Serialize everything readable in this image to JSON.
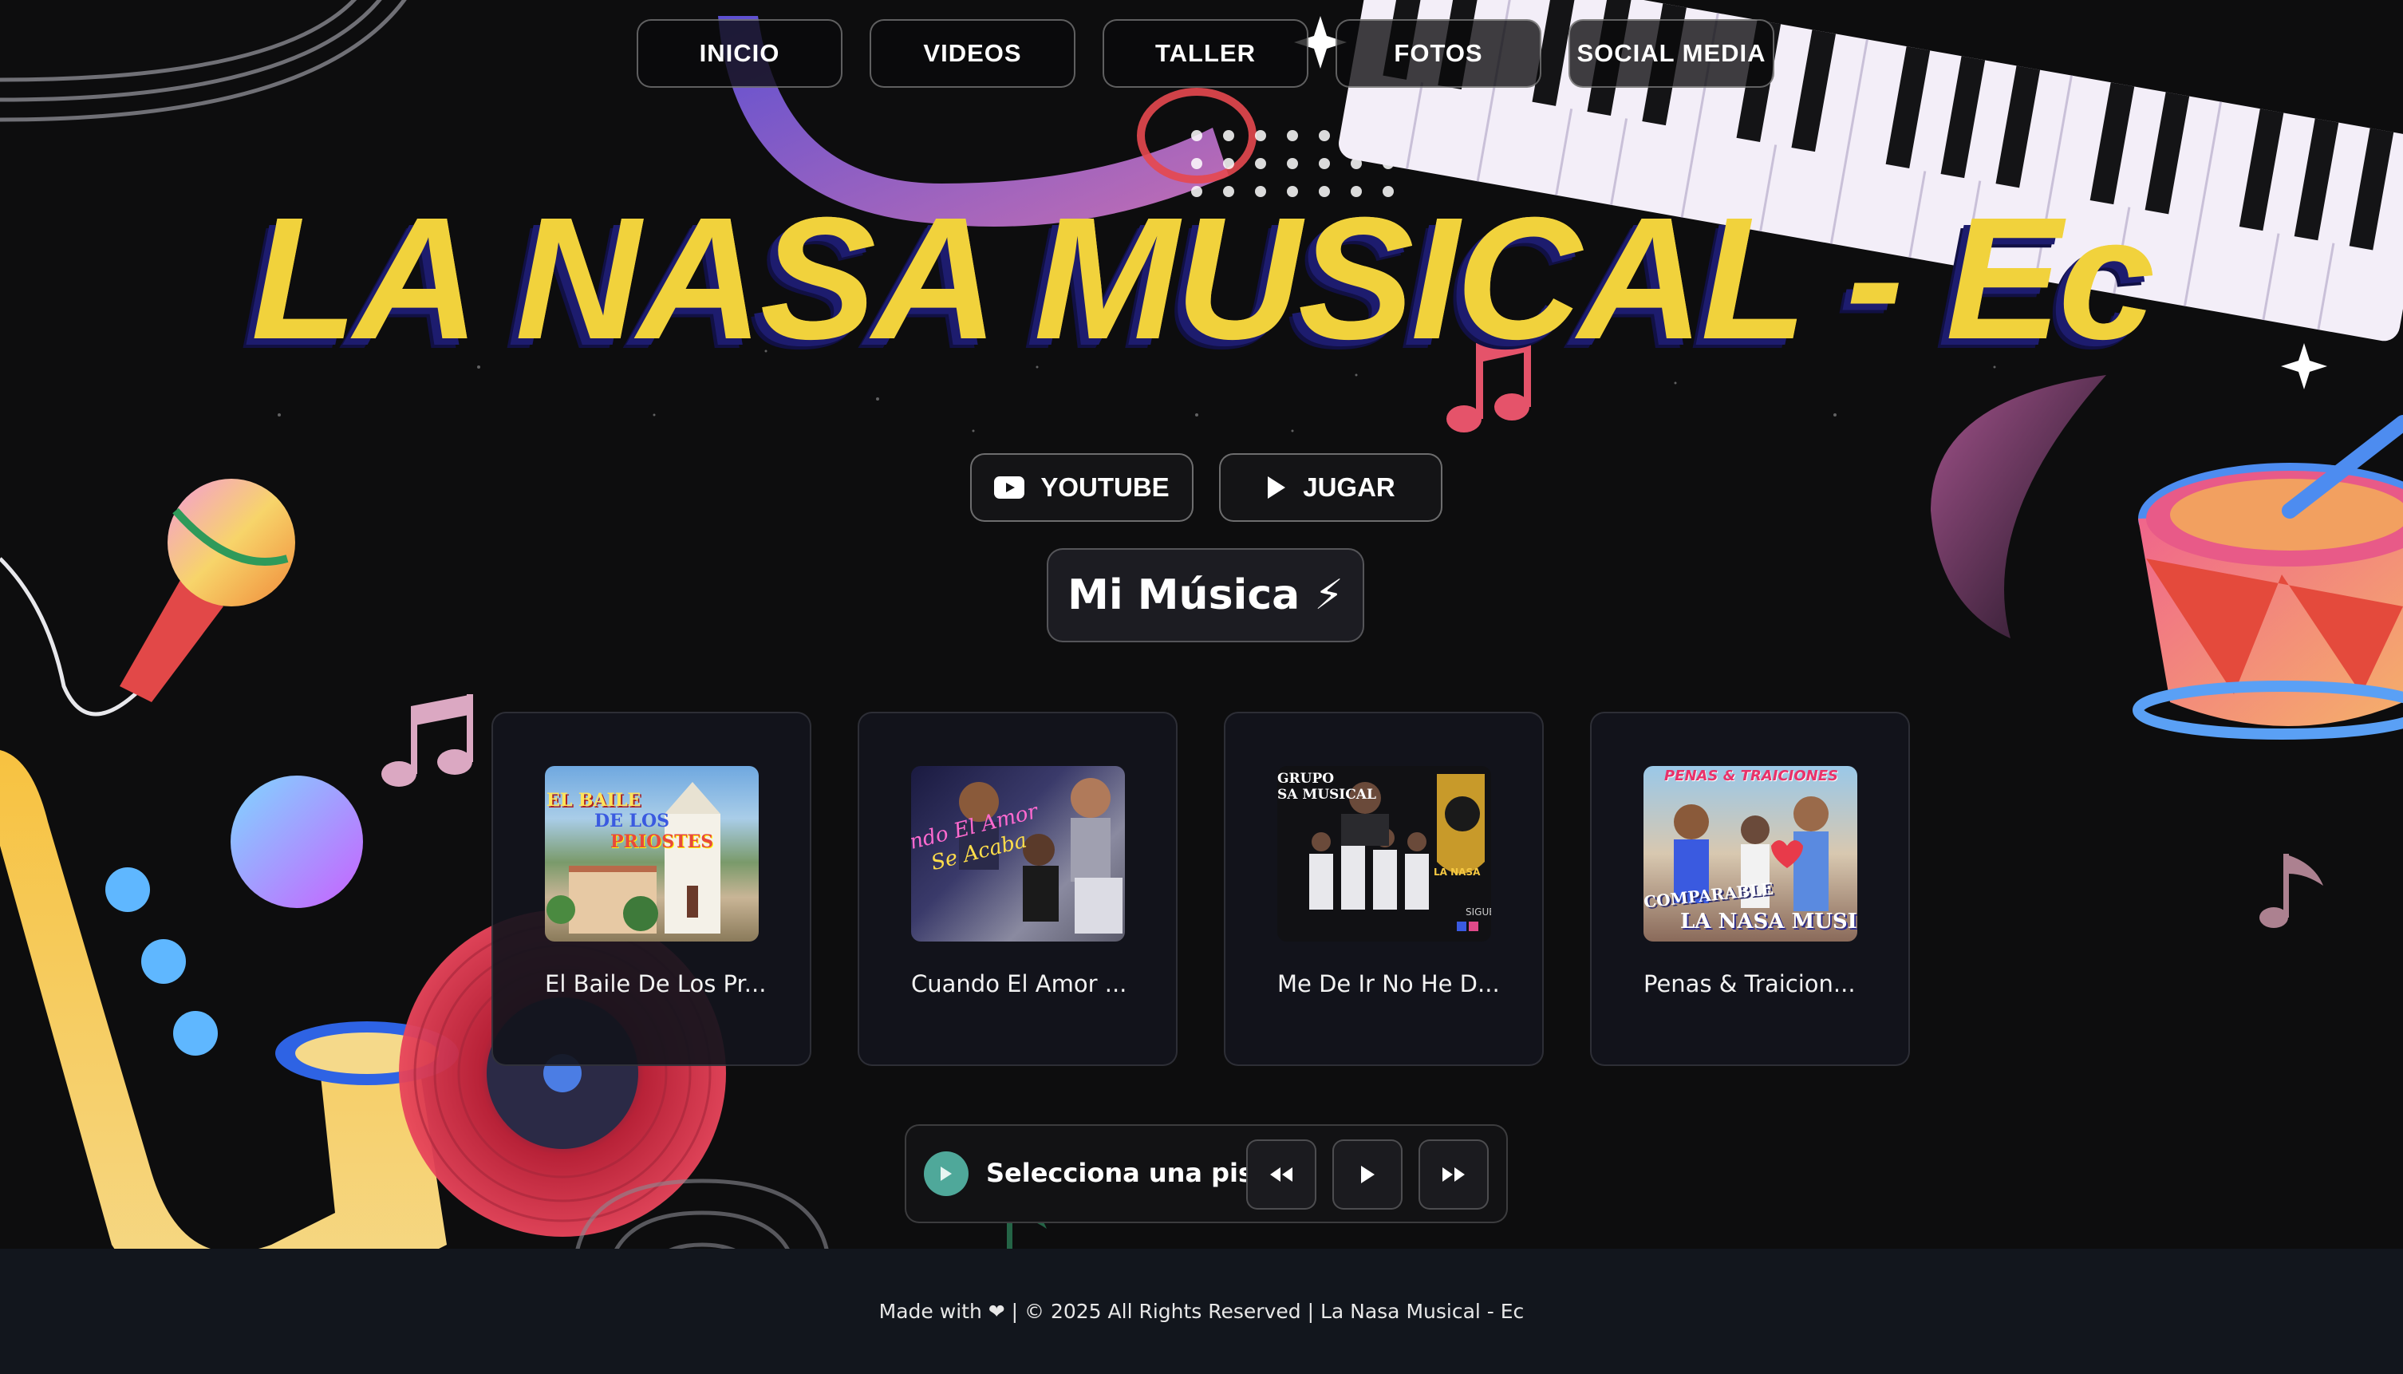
{
  "nav": {
    "items": [
      {
        "label": "INICIO"
      },
      {
        "label": "VIDEOS"
      },
      {
        "label": "TALLER"
      },
      {
        "label": "FOTOS"
      },
      {
        "label": "SOCIAL MEDIA"
      }
    ]
  },
  "hero": {
    "title": "LA NASA MUSICAL - Ec"
  },
  "actions": {
    "youtube_label": "YOUTUBE",
    "youtube_icon": "youtube-icon",
    "play_label": "JUGAR",
    "play_icon": "play-icon"
  },
  "section": {
    "title": "Mi Música ⚡"
  },
  "tracks": [
    {
      "title": "El Baile De Los Pr...",
      "thumb_text": [
        "EL BAILE",
        "DE LOS",
        "PRIOSTES"
      ]
    },
    {
      "title": "Cuando El Amor ...",
      "thumb_text": [
        "ndo El Amor",
        "Se Acaba"
      ]
    },
    {
      "title": "Me De Ir No He D...",
      "thumb_text": [
        "GRUPO",
        "SA MUSICAL",
        "LA NASA",
        "SIGUE"
      ]
    },
    {
      "title": "Penas & Traicion...",
      "thumb_text": [
        "PENAS & TRAICIONES",
        "COMPARABLE",
        "LA NASA MUSI"
      ]
    }
  ],
  "player": {
    "now_playing": "Selecciona una pista",
    "icons": [
      "play-icon",
      "rewind-icon",
      "play-icon",
      "fast-forward-icon"
    ]
  },
  "footer": {
    "text": "Made with ❤ | © 2025 All Rights Reserved | La Nasa Musical - Ec"
  },
  "colors": {
    "background": "#0d0d0e",
    "title_yellow": "#f1d23c",
    "title_shadow": "#1d1c6e",
    "footer_bg": "#12161d",
    "player_accent": "#4fa89a"
  }
}
